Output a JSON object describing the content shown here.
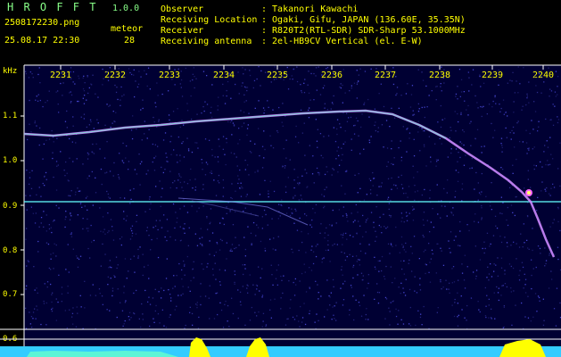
{
  "header": {
    "app_title": "H R O F F T",
    "version": "1.0.0",
    "filename": "2508172230.png",
    "datetime": "25.08.17 22:30",
    "meteor_label": "meteor",
    "meteor_count": "28"
  },
  "info": {
    "observer_label": "Observer",
    "observer_value": ": Takanori Kawachi",
    "location_label": "Receiving Location",
    "location_value": ": Ogaki, Gifu, JAPAN (136.60E, 35.35N)",
    "receiver_label": "Receiver",
    "receiver_value": ": R820T2(RTL-SDR) SDR-Sharp 53.1000MHz",
    "antenna_label": "Receiving antenna",
    "antenna_value": ": 2el-HB9CV Vertical (el. E-W)"
  },
  "axis": {
    "y_unit": "kHz",
    "x_ticks": [
      "2231",
      "2232",
      "2233",
      "2234",
      "2235",
      "2236",
      "2237",
      "2238",
      "2239",
      "2240"
    ],
    "y_ticks": [
      "1.1",
      "1.0",
      "0.9",
      "0.8",
      "0.7",
      "0.6"
    ]
  },
  "colors": {
    "background": "#000033",
    "label": "#ffff00",
    "trace": "#cc88ff",
    "beacon": "#66ffff",
    "bottom_band": "#33ccff"
  }
}
